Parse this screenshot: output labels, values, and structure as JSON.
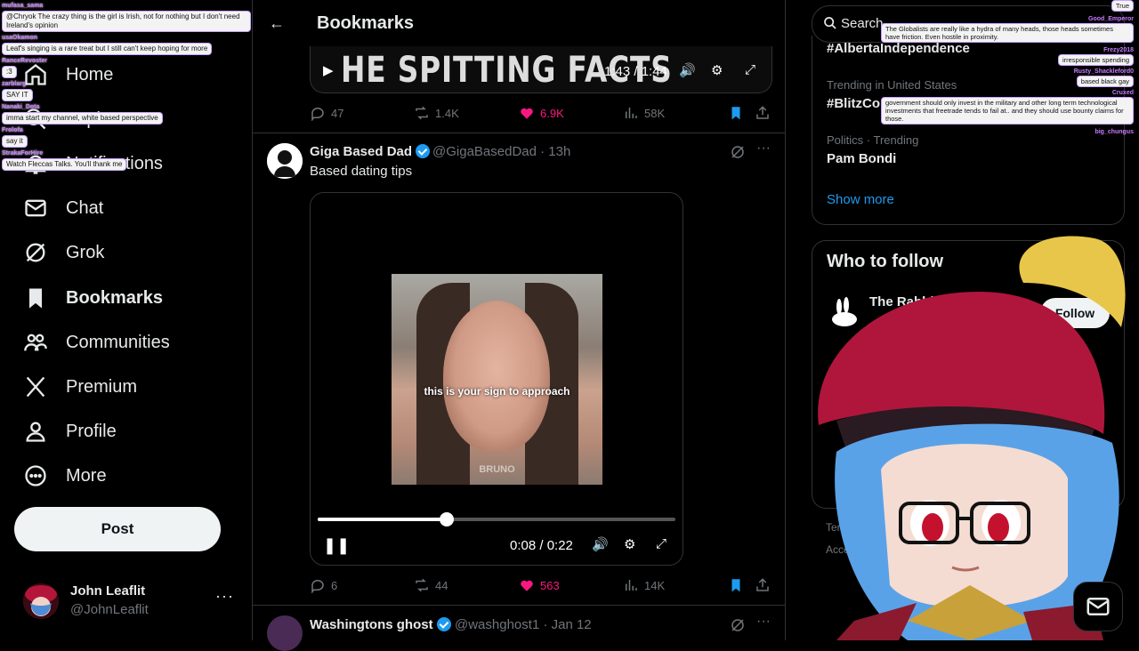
{
  "nav": {
    "items": [
      {
        "label": "Home"
      },
      {
        "label": "Explore"
      },
      {
        "label": "Notifications"
      },
      {
        "label": "Chat"
      },
      {
        "label": "Grok"
      },
      {
        "label": "Bookmarks"
      },
      {
        "label": "Communities"
      },
      {
        "label": "Premium"
      },
      {
        "label": "Profile"
      },
      {
        "label": "More"
      }
    ],
    "post_label": "Post"
  },
  "account": {
    "name": "John Leaflit",
    "handle": "@JohnLeaflit",
    "more": "···"
  },
  "chat_overlay": [
    {
      "user": "mufasa_sama",
      "text": "@Chryok The crazy thing is the girl is Irish, not for nothing but I don't need Ireland's opinion"
    },
    {
      "user": "usaOkamon",
      "text": "Leaf's singing is a rare treat but I still can't keep hoping for more"
    },
    {
      "user": "RanceRevoster",
      "text": ":3"
    },
    {
      "user": "zarblarg",
      "text": "SAY IT"
    },
    {
      "user": "Nanaki_Dota",
      "text": "imma start my channel, white based perspective"
    },
    {
      "user": "Frolofa",
      "text": "say it"
    },
    {
      "user": "StrakaForHire",
      "text": "Watch Fleccas Talks. You'll thank me"
    }
  ],
  "header": {
    "title": "Bookmarks",
    "back": "←"
  },
  "post1": {
    "video_text": "HE SPITTING FACTS",
    "time": "1:43 / 1:44",
    "replies": "47",
    "reposts": "1.4K",
    "likes": "6.9K",
    "views": "58K"
  },
  "post2": {
    "name": "Giga Based Dad",
    "handle": "@GigaBasedDad",
    "time": "· 13h",
    "text": "Based dating tips",
    "caption": "this is your sign to approach",
    "watermark": "BRUNO",
    "progress": 0.36,
    "video_time": "0:08 / 0:22",
    "replies": "6",
    "reposts": "44",
    "likes": "563",
    "views": "14K"
  },
  "post3": {
    "name": "Washingtons ghost",
    "handle": "@washghost1",
    "time": "· Jan 12"
  },
  "right": {
    "search_placeholder": "Search",
    "trends": [
      {
        "meta": "",
        "title": "#AlbertaIndependence"
      },
      {
        "meta": "Trending in United States",
        "title": "#BlitzCompetition"
      },
      {
        "meta": "Politics · Trending",
        "title": "Pam Bondi"
      }
    ],
    "show_more": "Show more",
    "who_to_follow": "Who to follow",
    "suggest_name": "The Rabbit Hole",
    "follow_label": "Follow",
    "footer_1": "Ter",
    "footer_2": "Acce"
  },
  "right_chat": [
    {
      "user": "",
      "text": "True"
    },
    {
      "user": "Good_Emperor",
      "text": "The Globalists are really like a hydra of many heads, those heads sometimes have friction. Even hostile in proximity."
    },
    {
      "user": "Frezy2018",
      "text": "irresponsible spending"
    },
    {
      "user": "Rusty_Shackleford0",
      "text": "based black gay"
    },
    {
      "user": "Cruxed",
      "text": "government should only invest in the military and other long term technological investments that freetrade tends to fail at.. and they should use bounty claims for those."
    },
    {
      "user": "big_chungus",
      "text": ""
    }
  ],
  "colors": {
    "accent": "#1d9bf0",
    "like": "#f91880",
    "bg": "#000000",
    "border": "#2f3336",
    "muted": "#71767b"
  }
}
